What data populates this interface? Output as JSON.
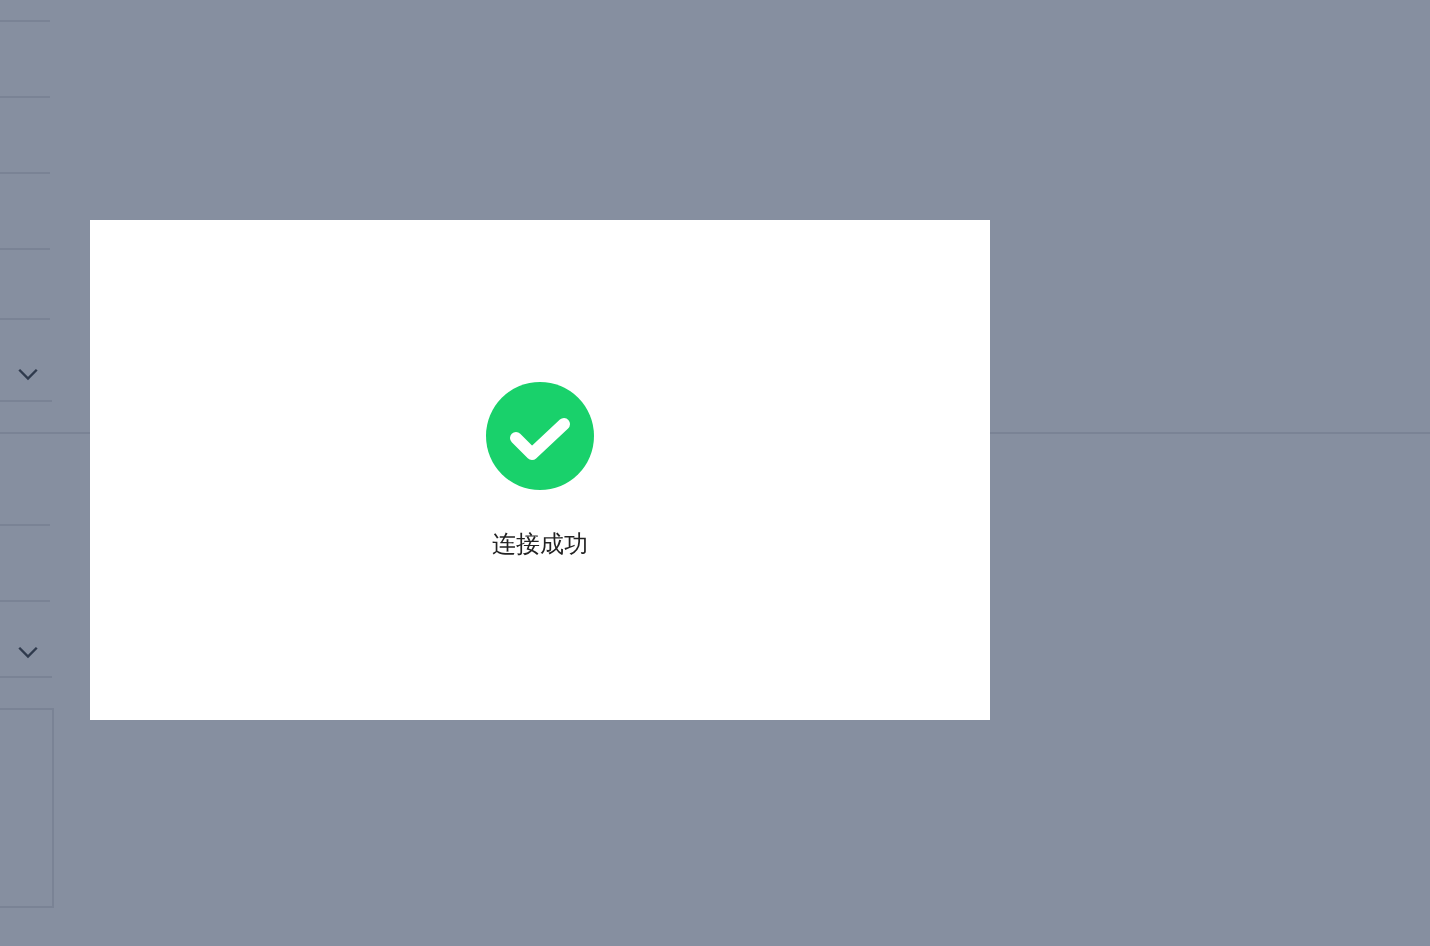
{
  "dialog": {
    "kind": "success",
    "message": "连接成功"
  }
}
